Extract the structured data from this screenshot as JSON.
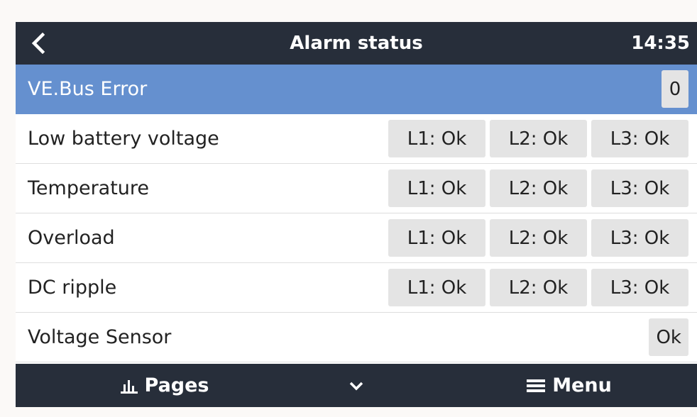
{
  "header": {
    "title": "Alarm status",
    "time": "14:35",
    "back_icon": "chevron-left-icon"
  },
  "rows": [
    {
      "label": "VE.Bus Error",
      "value": "0",
      "selected": true
    },
    {
      "label": "Low battery voltage",
      "phases": [
        "L1: Ok",
        "L2: Ok",
        "L3: Ok"
      ]
    },
    {
      "label": "Temperature",
      "phases": [
        "L1: Ok",
        "L2: Ok",
        "L3: Ok"
      ]
    },
    {
      "label": "Overload",
      "phases": [
        "L1: Ok",
        "L2: Ok",
        "L3: Ok"
      ]
    },
    {
      "label": "DC ripple",
      "phases": [
        "L1: Ok",
        "L2: Ok",
        "L3: Ok"
      ]
    },
    {
      "label": "Voltage Sensor",
      "value": "Ok"
    }
  ],
  "footer": {
    "pages_label": "Pages",
    "pages_icon": "bar-chart-icon",
    "chevron_icon": "chevron-down-icon",
    "menu_label": "Menu",
    "menu_icon": "hamburger-menu-icon"
  },
  "colors": {
    "header_bg": "#272e3a",
    "selected_row": "#6590cf",
    "badge_bg": "#e4e4e4"
  }
}
